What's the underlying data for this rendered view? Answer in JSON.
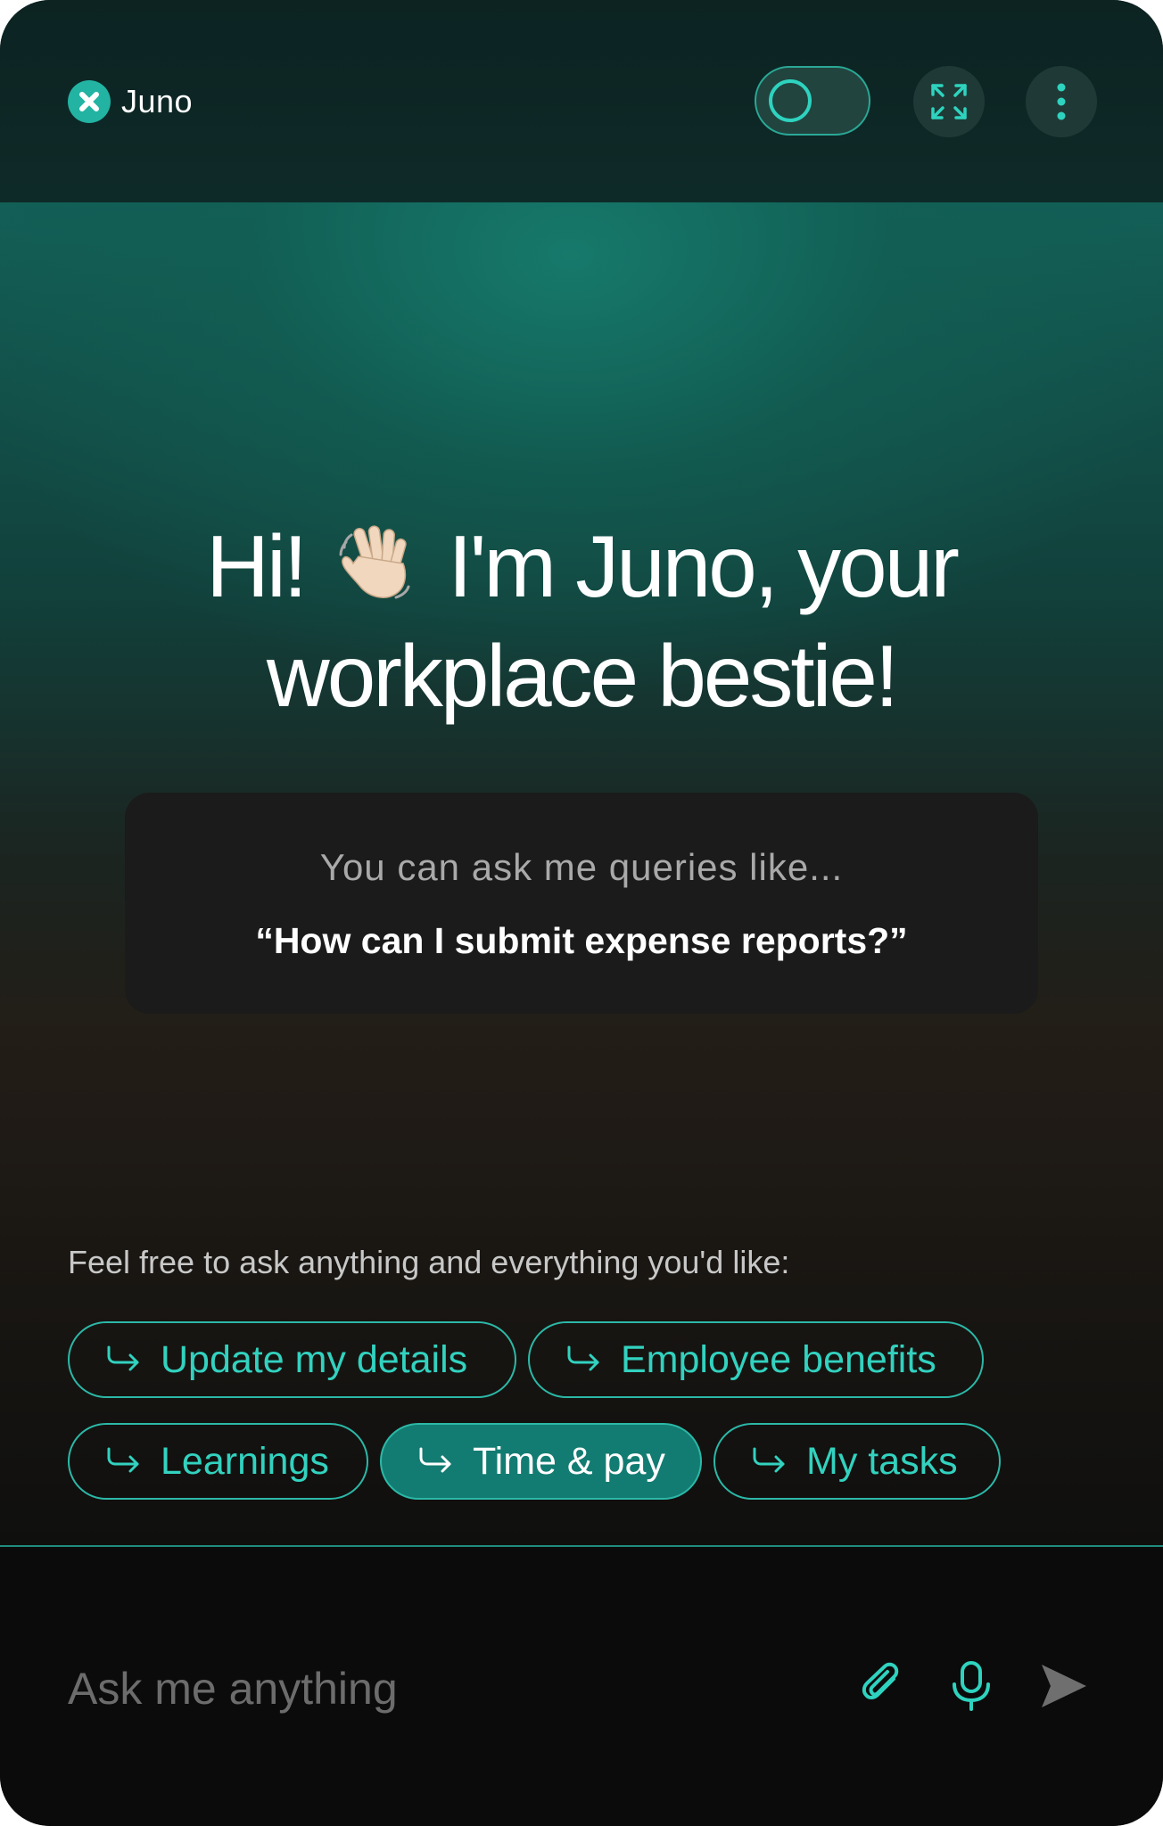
{
  "app": {
    "name": "Juno"
  },
  "header": {
    "toggle_state": "off",
    "icons": [
      "expand-icon",
      "more-vertical-icon"
    ]
  },
  "hero": {
    "greeting_part1": "Hi!",
    "greeting_part2": "I'm Juno, your",
    "greeting_line2": "workplace bestie!"
  },
  "query_card": {
    "intro": "You can ask me queries like...",
    "example": "“How can I submit expense reports?”"
  },
  "suggestions": {
    "prompt": "Feel free to ask anything and everything you'd like:",
    "chips": [
      {
        "label": "Update my details",
        "active": false
      },
      {
        "label": "Employee benefits",
        "active": false
      },
      {
        "label": "Learnings",
        "active": false
      },
      {
        "label": "Time & pay",
        "active": true
      },
      {
        "label": "My tasks",
        "active": false
      }
    ]
  },
  "composer": {
    "placeholder": "Ask me anything",
    "value": ""
  },
  "colors": {
    "accent": "#2ed3bf",
    "accent_dark": "#137c72",
    "background": "#0c0d0d"
  }
}
